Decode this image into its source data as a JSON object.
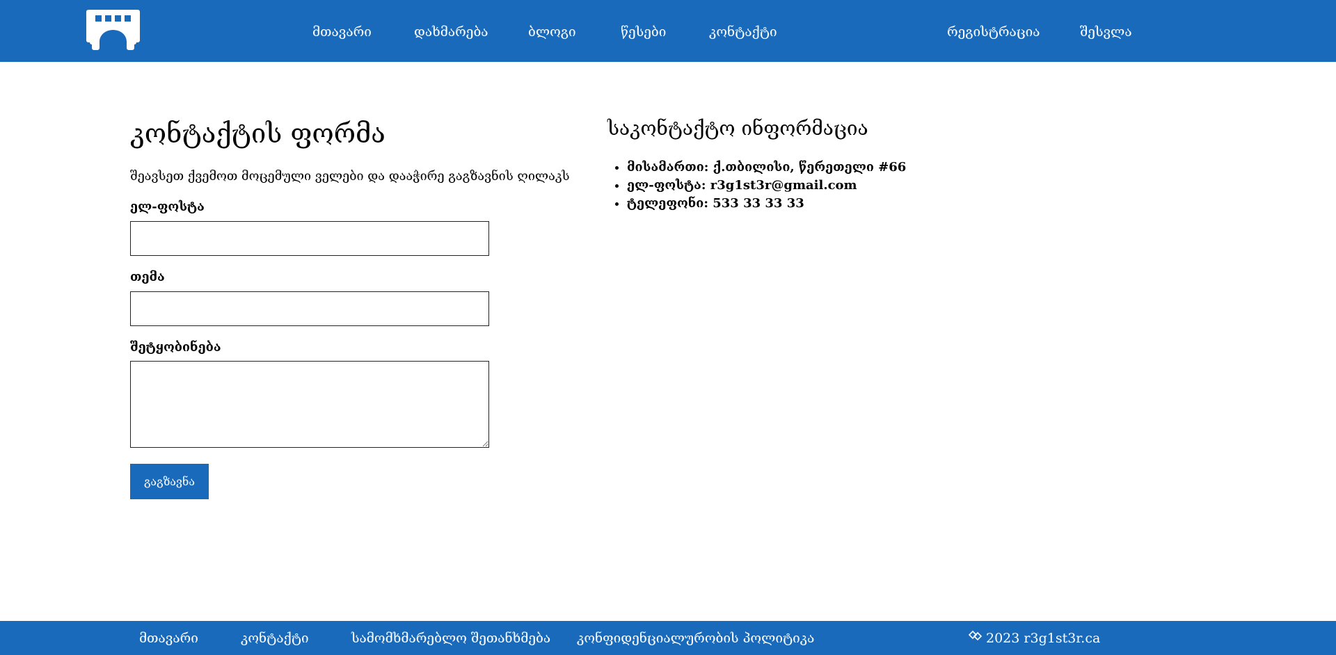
{
  "header": {
    "logo_icon": "bridge-icon",
    "nav": [
      {
        "label": "მთავარი"
      },
      {
        "label": "დახმარება"
      },
      {
        "label": "ბლოგი"
      },
      {
        "label": "წესები"
      },
      {
        "label": "კონტაქტი"
      }
    ],
    "auth": [
      {
        "label": "რეგისტრაცია"
      },
      {
        "label": "შესვლა"
      }
    ]
  },
  "contact_form": {
    "title": "კონტაქტის ფორმა",
    "description": "შეავსეთ ქვემოთ მოცემული ველები და დააჭირე გაგზავნის ღილაკს",
    "email_label": "ელ-ფოსტა",
    "email_value": "",
    "subject_label": "თემა",
    "subject_value": "",
    "message_label": "შეტყობინება",
    "message_value": "",
    "submit_label": "გაგზავნა"
  },
  "contact_info": {
    "title": "საკონტაქტო ინფორმაცია",
    "items": [
      "მისამართი: ქ.თბილისი, წერეთელი #66",
      "ელ-ფოსტა: r3g1st3r@gmail.com",
      "ტელეფონი: 533 33 33 33"
    ]
  },
  "footer": {
    "links": [
      {
        "label": "მთავარი"
      },
      {
        "label": "კონტაქტი"
      },
      {
        "label": "სამომხმარებლო შეთანხმება"
      },
      {
        "label": "კონფიდენციალურობის პოლიტიკა"
      }
    ],
    "copyright_icon": "diamond-icon",
    "copyright": "2023 r3g1st3r.ca"
  },
  "colors": {
    "primary": "#1a6abb",
    "text": "#000000",
    "on_primary": "#ffffff"
  }
}
